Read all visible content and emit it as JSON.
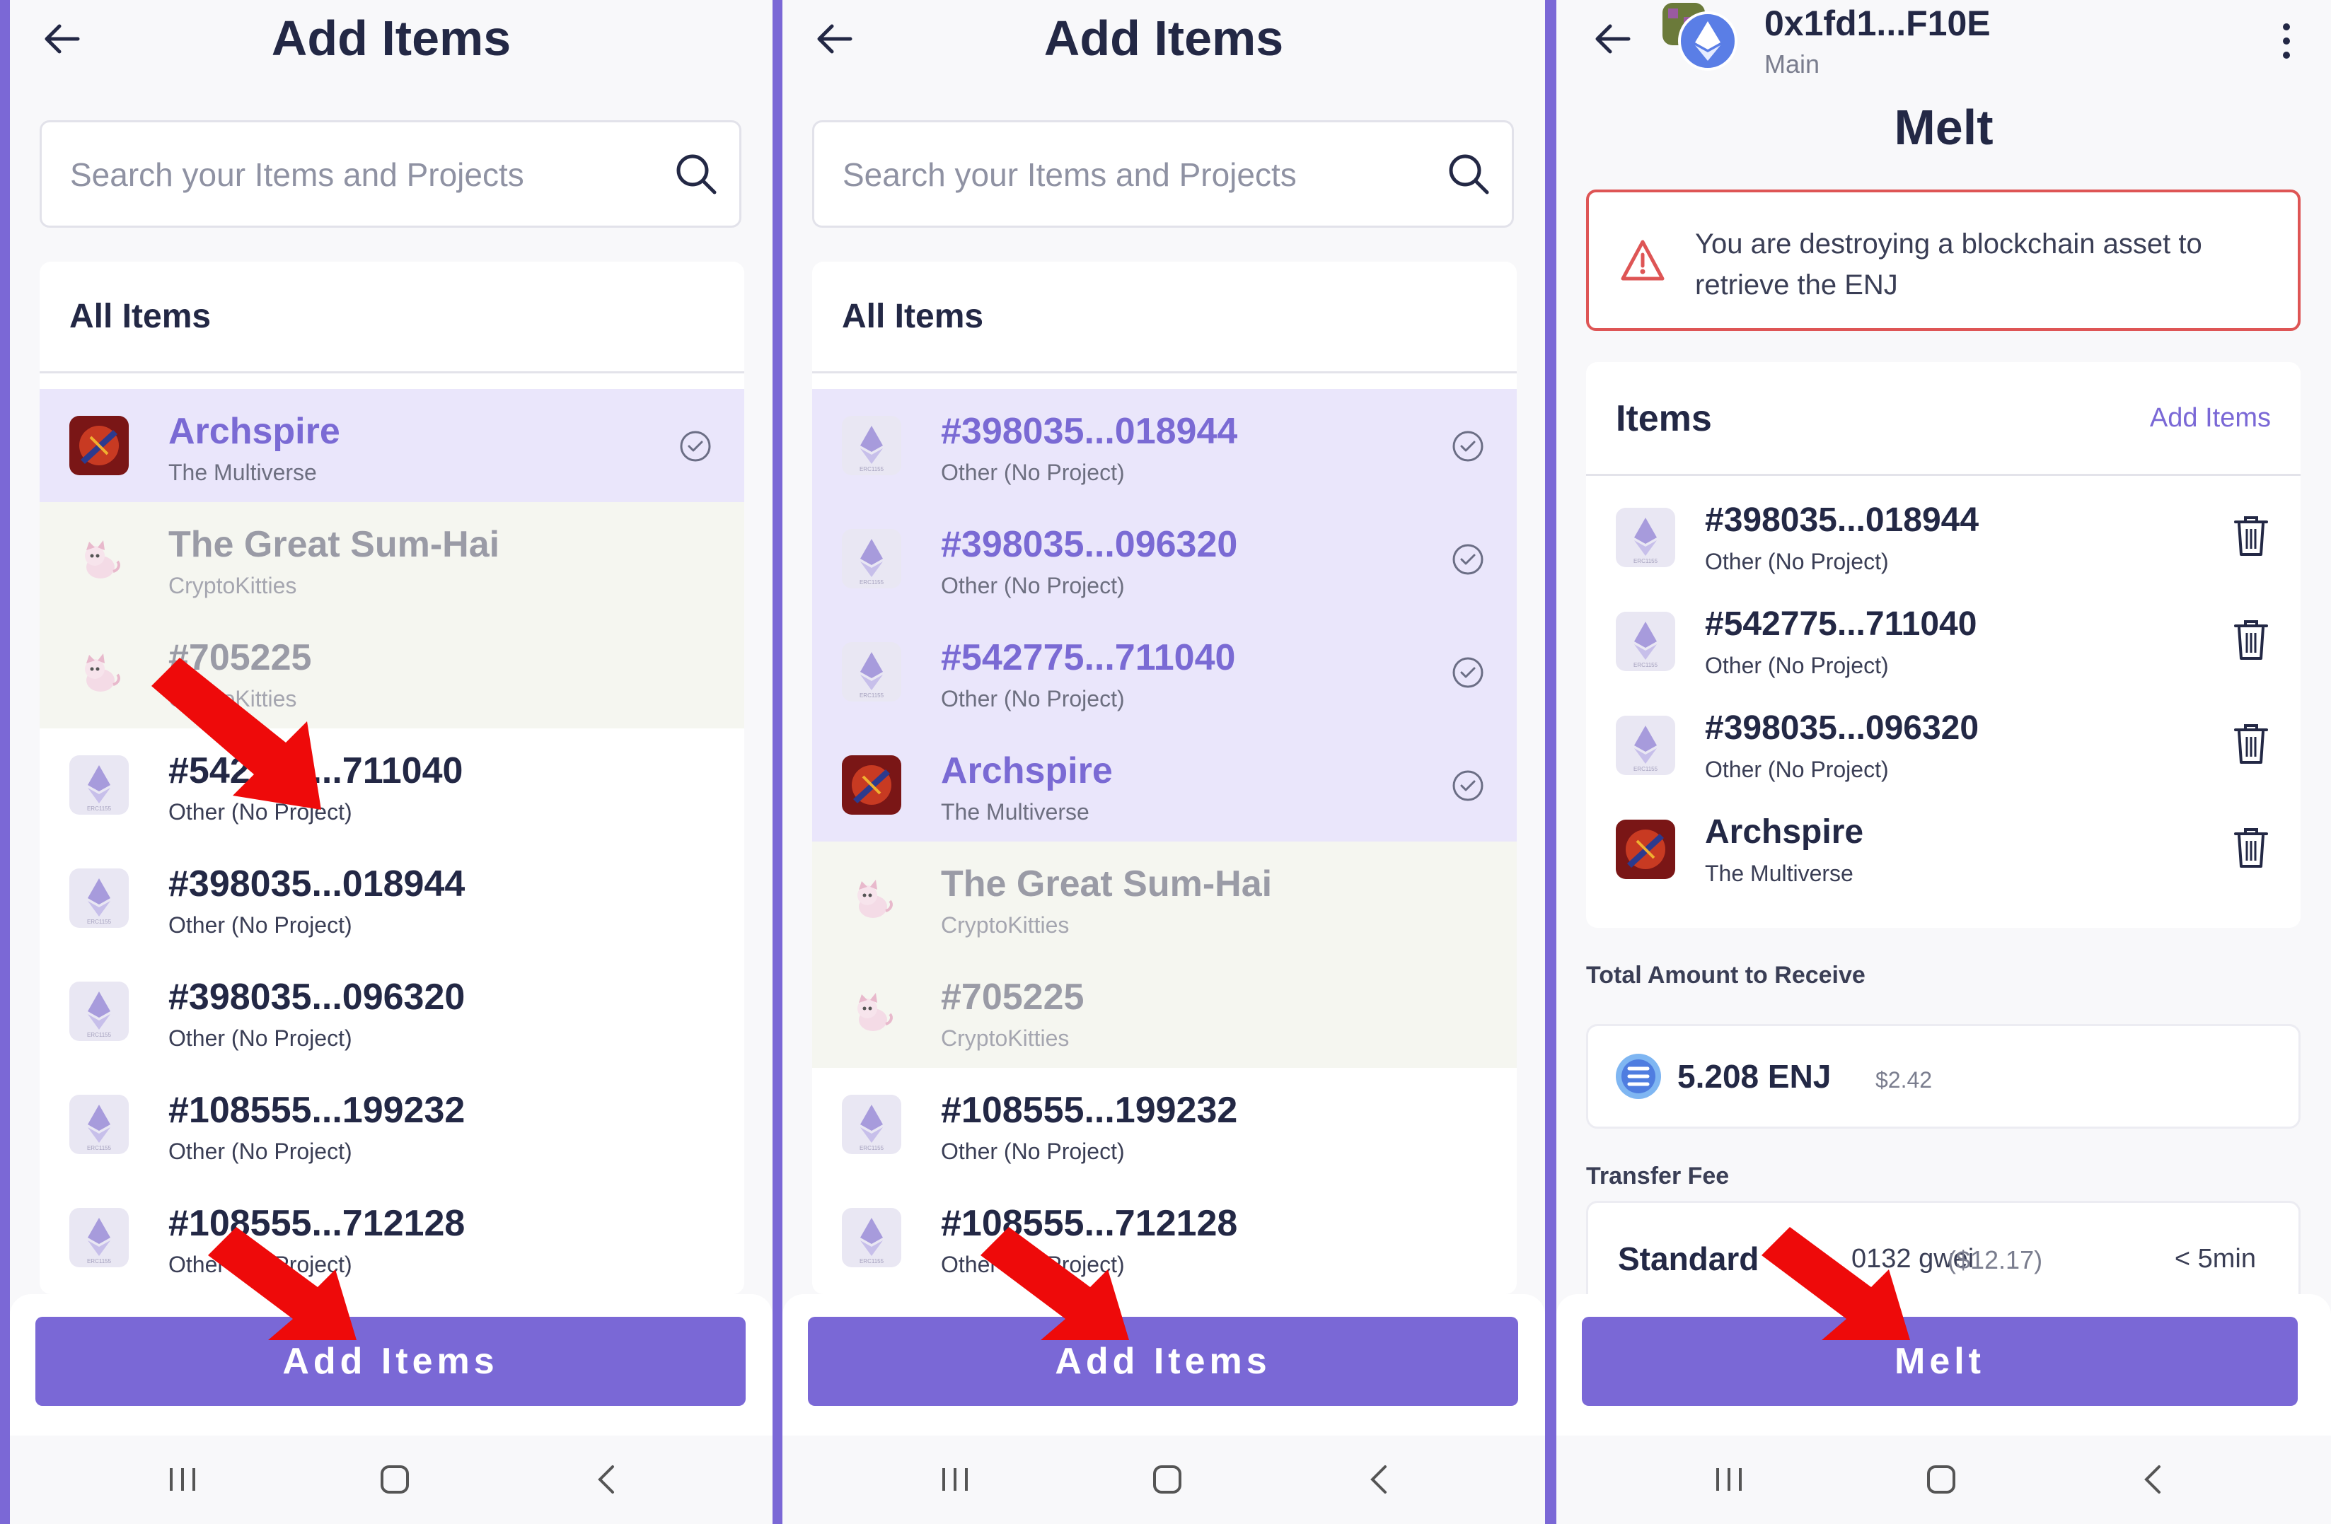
{
  "colors": {
    "accent": "#7a68d6",
    "frame": "#7b68d6",
    "danger": "#de5555",
    "text": "#232845",
    "arrow": "#ee0a0a"
  },
  "icons": {
    "back": "arrow-left-icon",
    "search": "search-icon",
    "check": "check-circle-icon",
    "trash": "trash-icon",
    "more": "more-vertical-icon",
    "warning": "warning-triangle-icon",
    "erc1155": "ethereum-erc1155-icon",
    "enj": "enjin-coin-icon"
  },
  "screens": [
    {
      "title": "Add Items",
      "search_placeholder": "Search your Items and Projects",
      "list_header": "All Items",
      "rows": [
        {
          "name": "Archspire",
          "sub": "The Multiverse",
          "state": "selected",
          "icon": "archspire"
        },
        {
          "name": "The Great Sum-Hai",
          "sub": "CryptoKitties",
          "state": "disabled",
          "icon": "kitty"
        },
        {
          "name": "#705225",
          "sub": "CryptoKitties",
          "state": "disabled",
          "icon": "kitty"
        },
        {
          "name": "#542775...711040",
          "sub": "Other (No Project)",
          "state": "normal",
          "icon": "erc1155"
        },
        {
          "name": "#398035...018944",
          "sub": "Other (No Project)",
          "state": "normal",
          "icon": "erc1155"
        },
        {
          "name": "#398035...096320",
          "sub": "Other (No Project)",
          "state": "normal",
          "icon": "erc1155"
        },
        {
          "name": "#108555...199232",
          "sub": "Other (No Project)",
          "state": "normal",
          "icon": "erc1155"
        },
        {
          "name": "#108555...712128",
          "sub": "Other (No Project)",
          "state": "normal",
          "icon": "erc1155"
        }
      ],
      "button_label": "Add Items"
    },
    {
      "title": "Add Items",
      "search_placeholder": "Search your Items and Projects",
      "list_header": "All Items",
      "rows": [
        {
          "name": "#398035...018944",
          "sub": "Other (No Project)",
          "state": "selected",
          "icon": "erc1155"
        },
        {
          "name": "#398035...096320",
          "sub": "Other (No Project)",
          "state": "selected",
          "icon": "erc1155"
        },
        {
          "name": "#542775...711040",
          "sub": "Other (No Project)",
          "state": "selected",
          "icon": "erc1155"
        },
        {
          "name": "Archspire",
          "sub": "The Multiverse",
          "state": "selected",
          "icon": "archspire"
        },
        {
          "name": "The Great Sum-Hai",
          "sub": "CryptoKitties",
          "state": "disabled",
          "icon": "kitty"
        },
        {
          "name": "#705225",
          "sub": "CryptoKitties",
          "state": "disabled",
          "icon": "kitty"
        },
        {
          "name": "#108555...199232",
          "sub": "Other (No Project)",
          "state": "normal",
          "icon": "erc1155"
        },
        {
          "name": "#108555...712128",
          "sub": "Other (No Project)",
          "state": "normal",
          "icon": "erc1155"
        }
      ],
      "button_label": "Add Items"
    }
  ],
  "melt": {
    "wallet_name": "0x1fd1...F10E",
    "wallet_sub": "Main",
    "title": "Melt",
    "warning": "You are destroying a blockchain asset to retrieve the ENJ",
    "items_header": "Items",
    "add_items_link": "Add Items",
    "items": [
      {
        "name": "#398035...018944",
        "sub": "Other (No Project)",
        "icon": "erc1155"
      },
      {
        "name": "#542775...711040",
        "sub": "Other (No Project)",
        "icon": "erc1155"
      },
      {
        "name": "#398035...096320",
        "sub": "Other (No Project)",
        "icon": "erc1155"
      },
      {
        "name": "Archspire",
        "sub": "The Multiverse",
        "icon": "archspire"
      }
    ],
    "total_label": "Total Amount to Receive",
    "amount": "5.208 ENJ",
    "amount_usd": "$2.42",
    "fee_label": "Transfer Fee",
    "fee_name": "Standard",
    "fee_gwei": "0132 gwei",
    "fee_usd": "($12.17)",
    "fee_time": "< 5min",
    "button_label": "Melt"
  }
}
